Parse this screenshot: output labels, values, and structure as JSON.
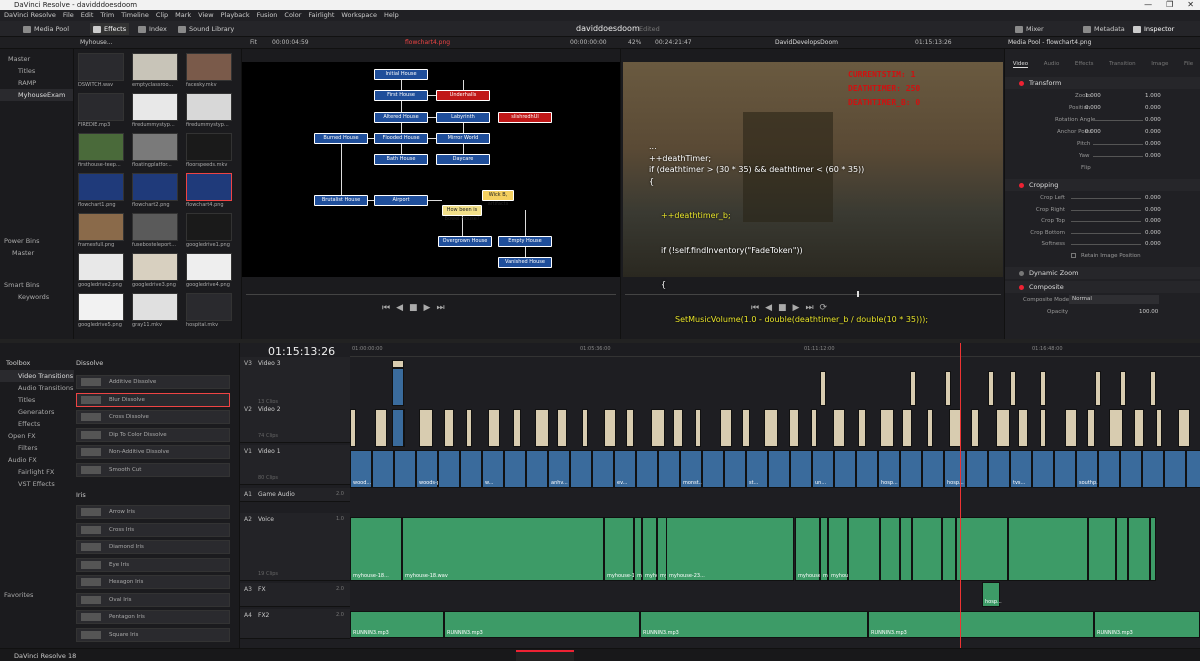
{
  "window": {
    "title": "DaVinci Resolve - davidddoesdoom",
    "controls": [
      "—",
      "❐",
      "✕"
    ]
  },
  "menu": [
    "DaVinci Resolve",
    "File",
    "Edit",
    "Trim",
    "Timeline",
    "Clip",
    "Mark",
    "View",
    "Playback",
    "Fusion",
    "Color",
    "Fairlight",
    "Workspace",
    "Help"
  ],
  "toolbar": {
    "media_pool": "Media Pool",
    "effects": "Effects",
    "index": "Index",
    "sound_library": "Sound Library",
    "project_name": "daviddoesdoom",
    "project_status": "Edited",
    "mixer": "Mixer",
    "metadata": "Metadata",
    "inspector": "Inspector"
  },
  "subbar": {
    "bin_name": "Myhouse...",
    "fit": "Fit",
    "src_tc": "00:00:04:59",
    "src_clip": "flowchart4.png",
    "src_tc2": "00:00:00:00",
    "zoom": "42%",
    "tl_dur": "00:24:21:47",
    "tl_name": "DavidDevelopsDoom",
    "rec_tc": "01:15:13:26",
    "insp_title": "Media Pool - flowchart4.png"
  },
  "bins": {
    "master": "Master",
    "items": [
      "Titles",
      "RAMP",
      "MyhouseExam"
    ],
    "power_bins": "Power Bins",
    "pb_master": "Master",
    "smart_bins": "Smart Bins",
    "keywords": "Keywords"
  },
  "media": [
    {
      "name": "DSWITCH.wav",
      "color": "#2a2a2e",
      "icon": "waveform-icon"
    },
    {
      "name": "emptyclassroo...",
      "color": "#c8c4b8"
    },
    {
      "name": "facesky.mkv",
      "color": "#7a5a4a"
    },
    {
      "name": "FIREDIE.mp3",
      "color": "#2a2a2e",
      "icon": "audio-icon"
    },
    {
      "name": "firedummystyp...",
      "color": "#e8e8e8"
    },
    {
      "name": "firedummystyp...",
      "color": "#d8d8d8"
    },
    {
      "name": "firsthouse-teep...",
      "color": "#4a6a3a"
    },
    {
      "name": "floatingplatfor...",
      "color": "#7a7a7a"
    },
    {
      "name": "floorspeeds.mkv",
      "color": "#1a1a1a",
      "icon": "audio-icon"
    },
    {
      "name": "flowchart1.png",
      "color": "#1f3a7a"
    },
    {
      "name": "flowchart2.png",
      "color": "#1f3a7a"
    },
    {
      "name": "flowchart4.png",
      "color": "#1f3a7a"
    },
    {
      "name": "framesfull.png",
      "color": "#8a6a4a"
    },
    {
      "name": "fusebosteleport...",
      "color": "#5a5a5a"
    },
    {
      "name": "googledrive1.png",
      "color": "#1a1a1a",
      "icon": "audio-icon"
    },
    {
      "name": "googledrive2.png",
      "color": "#e8e8e8"
    },
    {
      "name": "googledrive3.png",
      "color": "#d8d0c0"
    },
    {
      "name": "googledrive4.png",
      "color": "#eeeeee"
    },
    {
      "name": "googledrive5.png",
      "color": "#f2f2f2"
    },
    {
      "name": "gray11.mkv",
      "color": "#e0e0e0"
    },
    {
      "name": "hospital.mkv",
      "color": "#2a2a2e"
    }
  ],
  "flowchart": {
    "nodes": [
      "Initial House",
      "First House",
      "Underhalls",
      "Altered House",
      "Labyrinth",
      "slishredhUl",
      "Burned House",
      "Flooded House",
      "Mirror World",
      "Bath House",
      "Daycare",
      "Brutalist House",
      "Airport",
      "How been is Bowel House?",
      "Wick B, artifacts",
      "Overgrown House",
      "Empty House",
      "Vanished House"
    ]
  },
  "game_hud": [
    "CURRENTSTIM: 1",
    "DEATHTIMER: 250",
    "DEATHTIMER_B: 0"
  ],
  "code": {
    "l1": "...",
    "l2": "++deathTimer;",
    "l3": "if (deathtimer > (30 * 35) && deathtimer < (60 * 35))",
    "l4": "{",
    "l5": "++deathtimer_b;",
    "l6": "if (!self.findInventory(\"FadeToken\"))",
    "l7": "{",
    "l8": "SetMusicVolume(1.0 - double(deathtimer_b / double(10 * 35)));",
    "l9": "}",
    "l10": "}",
    "l11": "..."
  },
  "inspector": {
    "tabs": [
      "Video",
      "Audio",
      "Effects",
      "Transition",
      "Image",
      "File"
    ],
    "transform": "Transform",
    "zoom_label": "Zoom",
    "zoom_x": "1.000",
    "zoom_y": "1.000",
    "pos_label": "Position",
    "pos_x": "0.000",
    "pos_y": "0.000",
    "rot_label": "Rotation Angle",
    "rot_val": "0.000",
    "anchor_label": "Anchor Point",
    "anchor_x": "0.000",
    "anchor_y": "0.000",
    "pitch_label": "Pitch",
    "pitch_val": "0.000",
    "yaw_label": "Yaw",
    "yaw_val": "0.000",
    "flip_label": "Flip",
    "cropping": "Cropping",
    "crop_left": "Crop Left",
    "crop_right": "Crop Right",
    "crop_top": "Crop Top",
    "crop_bottom": "Crop Bottom",
    "softness": "Softness",
    "crop_val": "0.000",
    "retain": "Retain Image Position",
    "dynamic_zoom": "Dynamic Zoom",
    "composite": "Composite",
    "comp_mode_label": "Composite Mode",
    "comp_mode": "Normal",
    "opacity_label": "Opacity",
    "opacity": "100.00"
  },
  "toolbox": {
    "title": "Toolbox",
    "items": [
      "Video Transitions",
      "Audio Transitions",
      "Titles",
      "Generators",
      "Effects",
      "Open FX",
      "Filters",
      "Audio FX",
      "Fairlight FX",
      "VST Effects"
    ],
    "favorites": "Favorites",
    "dissolve_hdr": "Dissolve",
    "dissolve": [
      "Additive Dissolve",
      "Blur Dissolve",
      "Cross Dissolve",
      "Dip To Color Dissolve",
      "Non-Additive Dissolve",
      "Smooth Cut"
    ],
    "iris_hdr": "Iris",
    "iris": [
      "Arrow Iris",
      "Cross Iris",
      "Diamond Iris",
      "Eye Iris",
      "Hexagon Iris",
      "Oval Iris",
      "Pentagon Iris",
      "Square Iris"
    ]
  },
  "timeline": {
    "timecode": "01:15:13:26",
    "ruler": [
      "01:00:00:00",
      "01:05:36:00",
      "01:11:12:00",
      "01:16:48:00"
    ],
    "exit": "Exit",
    "tracks": [
      {
        "id": "V3",
        "name": "Video 3",
        "clips": "13 Clips"
      },
      {
        "id": "V2",
        "name": "Video 2",
        "clips": "74 Clips"
      },
      {
        "id": "V1",
        "name": "Video 1",
        "clips": "80 Clips"
      },
      {
        "id": "A1",
        "name": "Game Audio",
        "ch": "2.0"
      },
      {
        "id": "A2",
        "name": "Voice",
        "ch": "1.0",
        "clips": "19 Clips"
      },
      {
        "id": "A3",
        "name": "FX",
        "ch": "2.0"
      },
      {
        "id": "A4",
        "name": "FX2",
        "ch": "2.0"
      }
    ],
    "v1_labels": [
      "wood...",
      "woods-pete...",
      "w...",
      "anhv...",
      "ev...",
      "monst...",
      "st...",
      "un...",
      "hosp...",
      "hosp...",
      "tvs...",
      "southp..."
    ],
    "a2_labels": [
      "myhouse-18...",
      "myhouse-18.wav",
      "myhouse-1...",
      "myh...",
      "myhouse-20.wav",
      "myh...",
      "myhouse-23...",
      "myhouse-21.wav",
      "myh...",
      "myhouse-24.wav"
    ],
    "a3_label": "hosp...",
    "a4_labels": [
      "RUNNIN3.mp3",
      "RUNNIN3.mp3",
      "RUNNIN3.mp3",
      "RUNNIN3.mp3",
      "RUNNIN3.mp3"
    ]
  },
  "status": {
    "app": "DaVinci Resolve 18"
  }
}
